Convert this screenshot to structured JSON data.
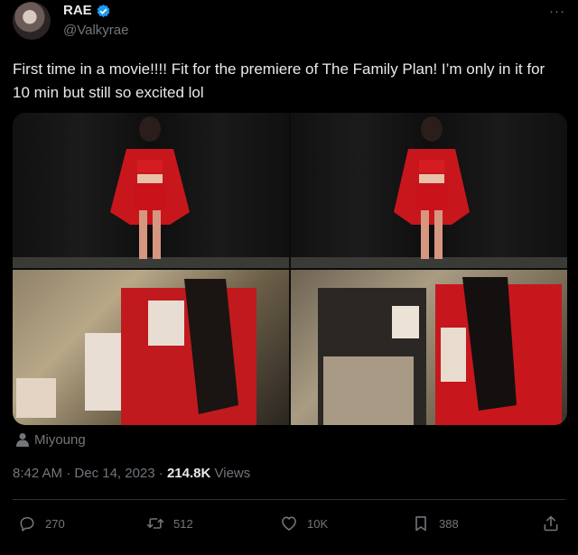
{
  "author": {
    "name": "RAE",
    "handle": "@Valkyrae",
    "verified": true
  },
  "menu": {
    "more_label": "···"
  },
  "tweet": {
    "text": "First time in a movie!!!! Fit for the premiere of The Family Plan! I’m only in it for 10 min but still so excited lol"
  },
  "media": {
    "credit": "Miyoung"
  },
  "meta": {
    "time": "8:42 AM",
    "separator": "·",
    "date": "Dec 14, 2023",
    "views_count": "214.8K",
    "views_label": "Views"
  },
  "actions": {
    "reply_count": "270",
    "retweet_count": "512",
    "like_count": "10K",
    "bookmark_count": "388"
  },
  "colors": {
    "background": "#000000",
    "text_primary": "#e7e9ea",
    "text_secondary": "#71767b",
    "verified_blue": "#1d9bf0",
    "divider": "#2f3336"
  }
}
